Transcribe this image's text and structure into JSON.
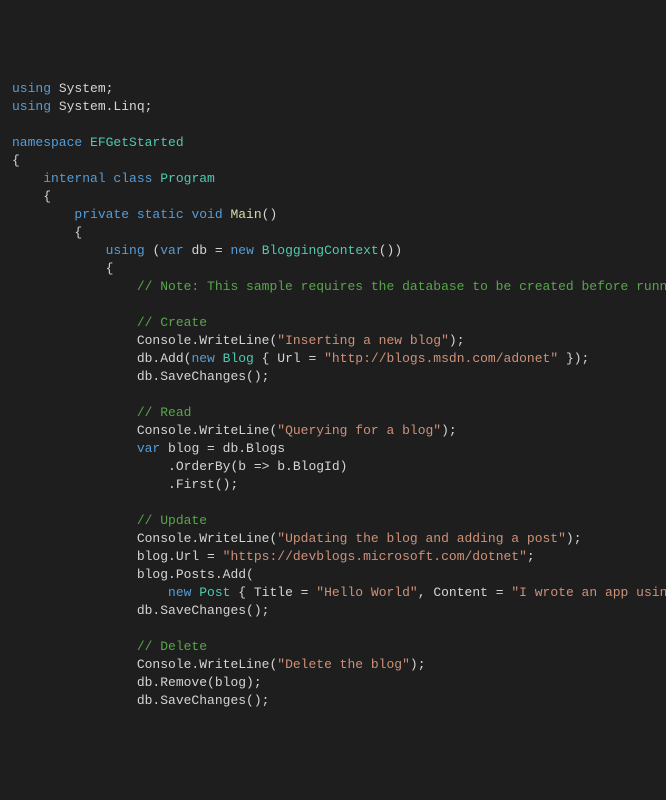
{
  "code": {
    "lines": [
      {
        "indent": 0,
        "tokens": [
          {
            "t": "using ",
            "c": "kw"
          },
          {
            "t": "System;",
            "c": "ns"
          }
        ]
      },
      {
        "indent": 0,
        "tokens": [
          {
            "t": "using ",
            "c": "kw"
          },
          {
            "t": "System.Linq;",
            "c": "ns"
          }
        ]
      },
      {
        "indent": 0,
        "tokens": []
      },
      {
        "indent": 0,
        "tokens": [
          {
            "t": "namespace ",
            "c": "kw"
          },
          {
            "t": "EFGetStarted",
            "c": "type"
          }
        ]
      },
      {
        "indent": 0,
        "tokens": [
          {
            "t": "{",
            "c": "ns"
          }
        ]
      },
      {
        "indent": 1,
        "tokens": [
          {
            "t": "internal class ",
            "c": "kw"
          },
          {
            "t": "Program",
            "c": "type"
          }
        ]
      },
      {
        "indent": 1,
        "tokens": [
          {
            "t": "{",
            "c": "ns"
          }
        ]
      },
      {
        "indent": 2,
        "tokens": [
          {
            "t": "private static void ",
            "c": "kw"
          },
          {
            "t": "Main",
            "c": "method"
          },
          {
            "t": "()",
            "c": "ns"
          }
        ]
      },
      {
        "indent": 2,
        "tokens": [
          {
            "t": "{",
            "c": "ns"
          }
        ]
      },
      {
        "indent": 3,
        "tokens": [
          {
            "t": "using ",
            "c": "kw"
          },
          {
            "t": "(",
            "c": "ns"
          },
          {
            "t": "var ",
            "c": "kw"
          },
          {
            "t": "db = ",
            "c": "ns"
          },
          {
            "t": "new ",
            "c": "kw"
          },
          {
            "t": "BloggingContext",
            "c": "type"
          },
          {
            "t": "())",
            "c": "ns"
          }
        ]
      },
      {
        "indent": 3,
        "tokens": [
          {
            "t": "{",
            "c": "ns"
          }
        ]
      },
      {
        "indent": 4,
        "tokens": [
          {
            "t": "// Note: This sample requires the database to be created before runni",
            "c": "com"
          }
        ]
      },
      {
        "indent": 4,
        "tokens": []
      },
      {
        "indent": 4,
        "tokens": [
          {
            "t": "// Create",
            "c": "com"
          }
        ]
      },
      {
        "indent": 4,
        "tokens": [
          {
            "t": "Console.WriteLine(",
            "c": "ns"
          },
          {
            "t": "\"Inserting a new blog\"",
            "c": "str"
          },
          {
            "t": ");",
            "c": "ns"
          }
        ]
      },
      {
        "indent": 4,
        "tokens": [
          {
            "t": "db.Add(",
            "c": "ns"
          },
          {
            "t": "new ",
            "c": "kw"
          },
          {
            "t": "Blog",
            "c": "type"
          },
          {
            "t": " { Url = ",
            "c": "ns"
          },
          {
            "t": "\"http://blogs.msdn.com/adonet\"",
            "c": "str"
          },
          {
            "t": " });",
            "c": "ns"
          }
        ]
      },
      {
        "indent": 4,
        "tokens": [
          {
            "t": "db.SaveChanges();",
            "c": "ns"
          }
        ]
      },
      {
        "indent": 4,
        "tokens": []
      },
      {
        "indent": 4,
        "tokens": [
          {
            "t": "// Read",
            "c": "com"
          }
        ]
      },
      {
        "indent": 4,
        "tokens": [
          {
            "t": "Console.WriteLine(",
            "c": "ns"
          },
          {
            "t": "\"Querying for a blog\"",
            "c": "str"
          },
          {
            "t": ");",
            "c": "ns"
          }
        ]
      },
      {
        "indent": 4,
        "tokens": [
          {
            "t": "var ",
            "c": "kw"
          },
          {
            "t": "blog = db.Blogs",
            "c": "ns"
          }
        ]
      },
      {
        "indent": 5,
        "tokens": [
          {
            "t": ".OrderBy(b => b.BlogId)",
            "c": "ns"
          }
        ]
      },
      {
        "indent": 5,
        "tokens": [
          {
            "t": ".First();",
            "c": "ns"
          }
        ]
      },
      {
        "indent": 4,
        "tokens": []
      },
      {
        "indent": 4,
        "tokens": [
          {
            "t": "// Update",
            "c": "com"
          }
        ]
      },
      {
        "indent": 4,
        "tokens": [
          {
            "t": "Console.WriteLine(",
            "c": "ns"
          },
          {
            "t": "\"Updating the blog and adding a post\"",
            "c": "str"
          },
          {
            "t": ");",
            "c": "ns"
          }
        ]
      },
      {
        "indent": 4,
        "tokens": [
          {
            "t": "blog.Url = ",
            "c": "ns"
          },
          {
            "t": "\"https://devblogs.microsoft.com/dotnet\"",
            "c": "str"
          },
          {
            "t": ";",
            "c": "ns"
          }
        ]
      },
      {
        "indent": 4,
        "tokens": [
          {
            "t": "blog.Posts.Add(",
            "c": "ns"
          }
        ]
      },
      {
        "indent": 5,
        "tokens": [
          {
            "t": "new ",
            "c": "kw"
          },
          {
            "t": "Post",
            "c": "type"
          },
          {
            "t": " { Title = ",
            "c": "ns"
          },
          {
            "t": "\"Hello World\"",
            "c": "str"
          },
          {
            "t": ", Content = ",
            "c": "ns"
          },
          {
            "t": "\"I wrote an app using",
            "c": "str"
          }
        ]
      },
      {
        "indent": 4,
        "tokens": [
          {
            "t": "db.SaveChanges();",
            "c": "ns"
          }
        ]
      },
      {
        "indent": 4,
        "tokens": []
      },
      {
        "indent": 4,
        "tokens": [
          {
            "t": "// Delete",
            "c": "com"
          }
        ]
      },
      {
        "indent": 4,
        "tokens": [
          {
            "t": "Console.WriteLine(",
            "c": "ns"
          },
          {
            "t": "\"Delete the blog\"",
            "c": "str"
          },
          {
            "t": ");",
            "c": "ns"
          }
        ]
      },
      {
        "indent": 4,
        "tokens": [
          {
            "t": "db.Remove(blog);",
            "c": "ns"
          }
        ]
      },
      {
        "indent": 4,
        "tokens": [
          {
            "t": "db.SaveChanges();",
            "c": "ns"
          }
        ]
      }
    ]
  }
}
